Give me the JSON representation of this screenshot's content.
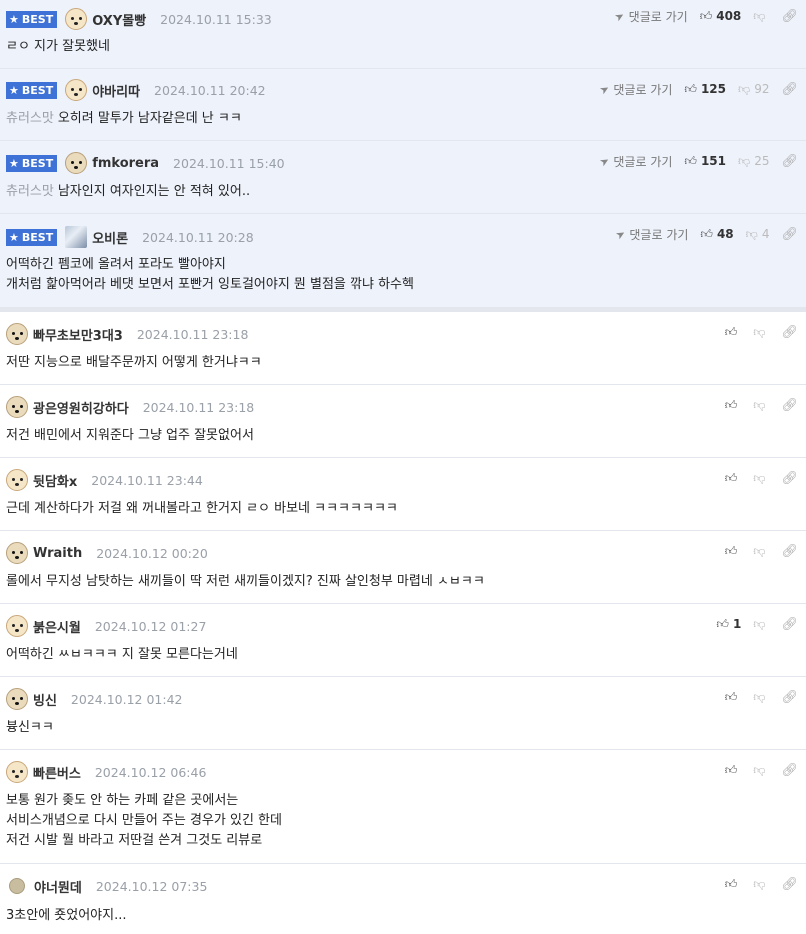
{
  "labels": {
    "best": "BEST",
    "reply": "댓글로 가기"
  },
  "best_comments": [
    {
      "nick": "OXY몰빵",
      "date": "2024.10.11 15:33",
      "up": "408",
      "down": "",
      "mention": "",
      "lines": [
        "ㄹㅇ 지가 잘못했네"
      ]
    },
    {
      "nick": "야바리따",
      "date": "2024.10.11 20:42",
      "up": "125",
      "down": "92",
      "mention": "츄러스맛",
      "lines": [
        "오히려 말투가 남자같은데 난 ㅋㅋ"
      ]
    },
    {
      "nick": "fmkorera",
      "date": "2024.10.11 15:40",
      "up": "151",
      "down": "25",
      "mention": "츄러스맛",
      "lines": [
        "남자인지 여자인지는 안 적혀 있어.."
      ]
    },
    {
      "nick": "오비론",
      "date": "2024.10.11 20:28",
      "up": "48",
      "down": "4",
      "mention": "",
      "lines": [
        "어떡하긴 펨코에 올려서 포라도 빨아야지",
        "개처럼 핥아먹어라 베댓 보면서 포빤거 잉토걸어야지 뭔 별점을 깎냐 하수헥"
      ]
    }
  ],
  "comments": [
    {
      "nick": "빠무초보만3대3",
      "date": "2024.10.11 23:18",
      "up": "",
      "lines": [
        "저딴 지능으로 배달주문까지 어떻게 한거냐ㅋㅋ"
      ]
    },
    {
      "nick": "광은영원히강하다",
      "date": "2024.10.11 23:18",
      "up": "",
      "lines": [
        "저건 배민에서 지워준다 그냥 업주 잘못없어서"
      ]
    },
    {
      "nick": "뒷담화x",
      "date": "2024.10.11 23:44",
      "up": "",
      "lines": [
        "근데 계산하다가 저걸 왜 꺼내볼라고 한거지 ㄹㅇ 바보네 ㅋㅋㅋㅋㅋㅋㅋ"
      ]
    },
    {
      "nick": "Wraith",
      "date": "2024.10.12 00:20",
      "up": "",
      "lines": [
        "롤에서 무지성 남탓하는 새끼들이 딱 저런 새끼들이겠지? 진짜 살인청부 마렵네 ㅅㅂㅋㅋ"
      ]
    },
    {
      "nick": "붉은시월",
      "date": "2024.10.12 01:27",
      "up": "1",
      "lines": [
        "어떡하긴 ㅆㅂㅋㅋㅋ 지 잘못 모른다는거네"
      ]
    },
    {
      "nick": "빙신",
      "date": "2024.10.12 01:42",
      "up": "",
      "lines": [
        "븅신ㅋㅋ"
      ]
    },
    {
      "nick": "빠른버스",
      "date": "2024.10.12 06:46",
      "up": "",
      "lines": [
        "보통 원가 좆도 안 하는 카페 같은 곳에서는",
        "서비스개념으로 다시 만들어 주는 경우가 있긴 한데",
        "저건 시발 뭘 바라고 저딴걸 쓴겨 그것도 리뷰로"
      ]
    },
    {
      "nick": "야너뭔데",
      "date": "2024.10.12 07:35",
      "up": "",
      "lines": [
        "3초안에 죳었어야지..."
      ]
    }
  ],
  "icons": {
    "thumb_up": "thumb-up-icon",
    "thumb_down": "thumb-down-icon",
    "link": "link-icon",
    "reply_arrow": "reply-arrow-icon",
    "star": "star-icon"
  },
  "colors": {
    "best_bg": "#eef2fb",
    "badge": "#3f72d6",
    "border": "#e3e6ec"
  }
}
